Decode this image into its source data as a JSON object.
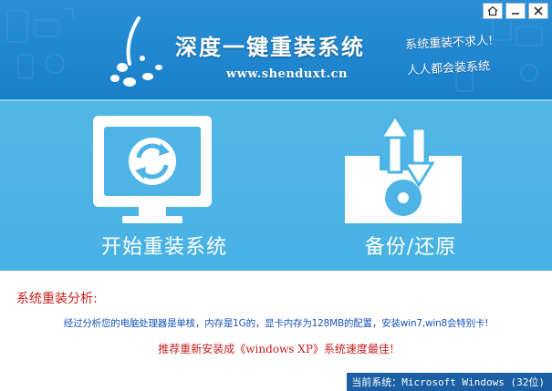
{
  "header": {
    "title": "深度一键重装系统",
    "url": "www.shenduxt.cn",
    "slogans": [
      "系统重装不求人!",
      "人人都会装系统"
    ]
  },
  "window_controls": [
    {
      "icon": "home-icon"
    },
    {
      "icon": "minimize-icon"
    },
    {
      "icon": "close-icon"
    }
  ],
  "actions": {
    "reinstall": {
      "label": "开始重装系统",
      "icon": "monitor-refresh-icon"
    },
    "backup": {
      "label": "备份/还原",
      "icon": "disk-transfer-icon"
    }
  },
  "analysis": {
    "title": "系统重装分析:",
    "detail": "经过分析您的电脑处理器是单核，内存是1G的，显卡内存为128MB的配置，安装win7,win8会特别卡!",
    "recommend": "推荐重新安装成《windows XP》系统速度最佳!"
  },
  "status": {
    "current_system": "当前系统：Microsoft Windows (32位)"
  },
  "colors": {
    "header_blue": "#1f86cf",
    "main_blue": "#4db4e5",
    "status_blue": "#1a5fa3",
    "alert_red": "#c81e1e",
    "detail_blue": "#1a55b8"
  }
}
